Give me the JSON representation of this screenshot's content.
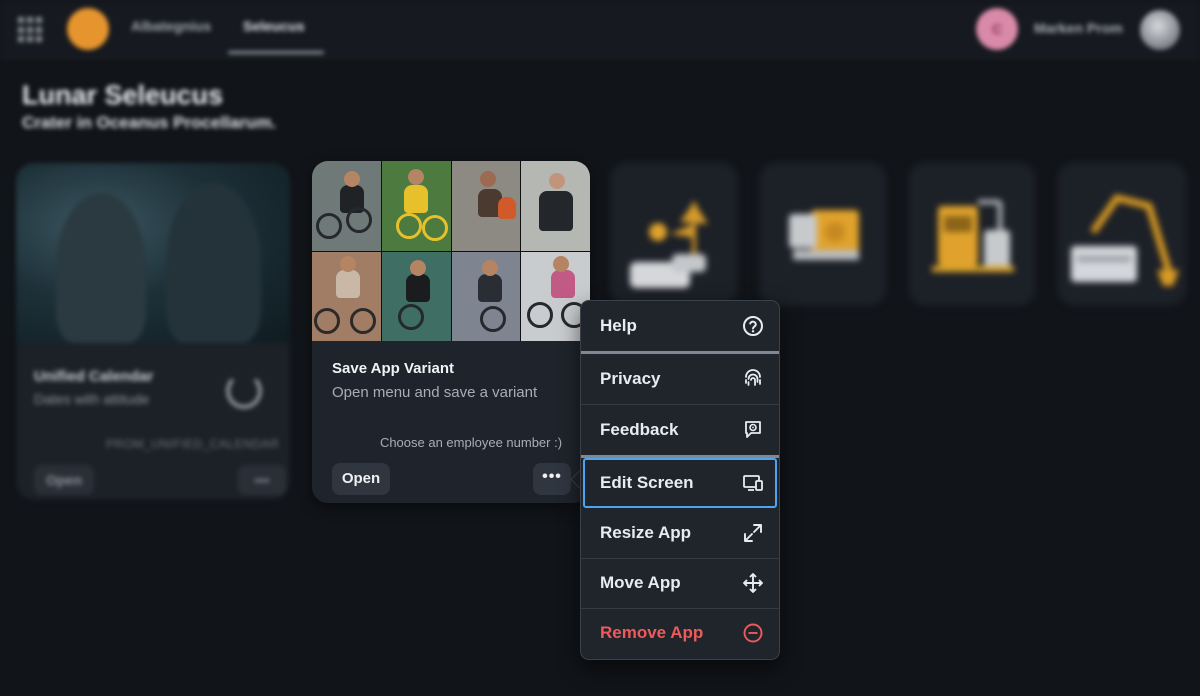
{
  "topbar": {
    "tabs": [
      {
        "label": "Albategnius"
      },
      {
        "label": "Seleucus"
      }
    ],
    "user": {
      "initial": "C",
      "name": "Marken Prom"
    }
  },
  "page": {
    "title": "Lunar Seleucus",
    "subtitle": "Crater in Oceanus Procellarum."
  },
  "calendar_card": {
    "title": "Unified Calendar",
    "subtitle": "Dates with attitude",
    "code": "PROM_UNIFIED_CALENDAR",
    "open_label": "Open",
    "more_label": "•••"
  },
  "main_card": {
    "title": "Save App Variant",
    "subtitle": "Open menu and save a variant",
    "footer": "Choose an employee number :)",
    "open_label": "Open",
    "more_label": "•••"
  },
  "menu": {
    "items": [
      {
        "label": "Help",
        "icon": "help-icon"
      },
      {
        "label": "Privacy",
        "icon": "fingerprint-icon"
      },
      {
        "label": "Feedback",
        "icon": "feedback-icon"
      },
      {
        "label": "Edit Screen",
        "icon": "edit-screen-icon"
      },
      {
        "label": "Resize App",
        "icon": "resize-icon"
      },
      {
        "label": "Move App",
        "icon": "move-icon"
      },
      {
        "label": "Remove App",
        "icon": "remove-icon"
      }
    ],
    "focused_item": "Edit Screen"
  },
  "colors": {
    "background": "#111418",
    "card": "#1f242c",
    "accent_orange": "#e6952e",
    "focus_blue": "#4da3ef",
    "danger_red": "#ee5a5a",
    "avatar_pink": "#d98aa8"
  }
}
